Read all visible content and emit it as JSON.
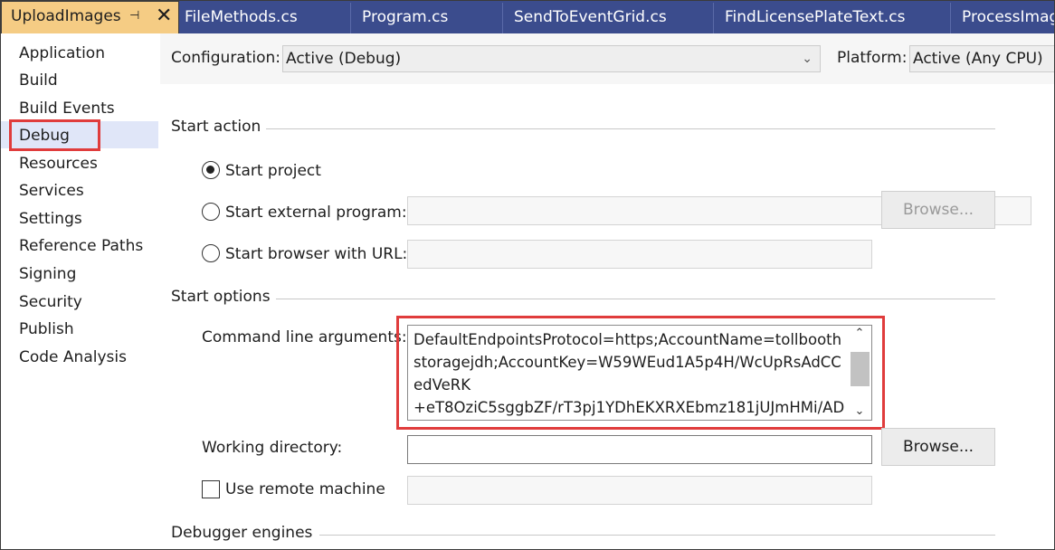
{
  "tabs": {
    "active": {
      "label": "UploadImages",
      "pin_glyph": "⊣",
      "close_glyph": "✕"
    },
    "items": [
      {
        "label": "FileMethods.cs"
      },
      {
        "label": "Program.cs"
      },
      {
        "label": "SendToEventGrid.cs"
      },
      {
        "label": "FindLicensePlateText.cs"
      },
      {
        "label": "ProcessImage"
      }
    ]
  },
  "sidebar": {
    "items": [
      {
        "label": "Application"
      },
      {
        "label": "Build"
      },
      {
        "label": "Build Events"
      },
      {
        "label": "Debug"
      },
      {
        "label": "Resources"
      },
      {
        "label": "Services"
      },
      {
        "label": "Settings"
      },
      {
        "label": "Reference Paths"
      },
      {
        "label": "Signing"
      },
      {
        "label": "Security"
      },
      {
        "label": "Publish"
      },
      {
        "label": "Code Analysis"
      }
    ],
    "selected": "Debug"
  },
  "config": {
    "configuration_label": "Configuration:",
    "configuration_value": "Active (Debug)",
    "platform_label": "Platform:",
    "platform_value": "Active (Any CPU)"
  },
  "start_action": {
    "header": "Start action",
    "start_project": "Start project",
    "start_external": "Start external program:",
    "start_browser": "Start browser with URL:",
    "browse_label": "Browse...",
    "selected": "start_project"
  },
  "start_options": {
    "header": "Start options",
    "cmd_args_label": "Command line arguments:",
    "cmd_args_value": "DefaultEndpointsProtocol=https;AccountName=tollboothstoragejdh;AccountKey=W59WEud1A5p4H/WcUpRsAdCCedVeRK\n+eT8OziC5sggbZF/rT3pj1YDhEKXRXEbmz181jUJmHMi/AD",
    "working_dir_label": "Working directory:",
    "working_dir_value": "",
    "browse_label": "Browse...",
    "remote_label": "Use remote machine",
    "remote_checked": false
  },
  "debugger": {
    "header": "Debugger engines"
  },
  "colors": {
    "tab_strip": "#3b4c8d",
    "active_tab": "#f5cc84",
    "highlight": "#e03c3c",
    "selected_nav": "#e0e6f8"
  }
}
